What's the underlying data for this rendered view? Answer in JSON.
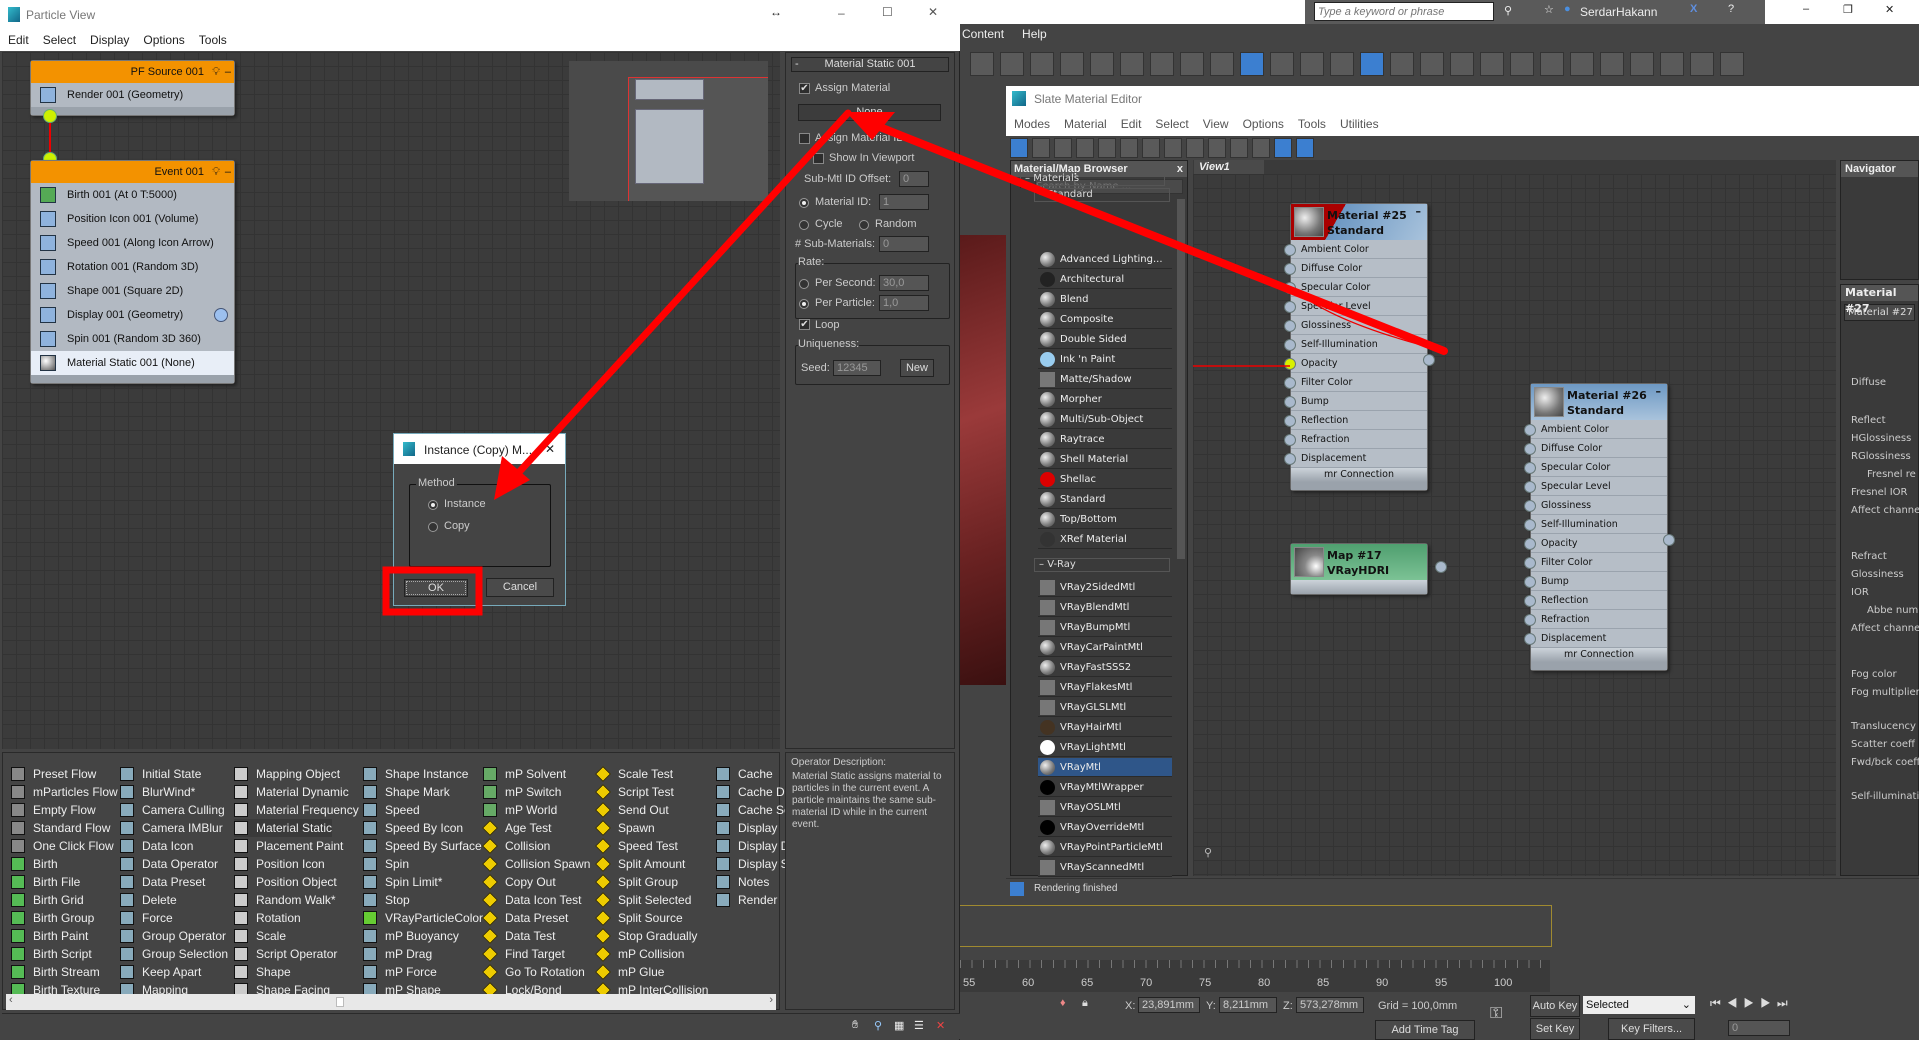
{
  "particle_view": {
    "title": "Particle View",
    "menu": [
      "Edit",
      "Select",
      "Display",
      "Options",
      "Tools"
    ],
    "pf_source": {
      "title": "PF Source 001",
      "rows": [
        "Render 001 (Geometry)"
      ]
    },
    "event": {
      "title": "Event 001",
      "rows": [
        "Birth 001 (At 0 T:5000)",
        "Position Icon 001 (Volume)",
        "Speed 001 (Along Icon Arrow)",
        "Rotation 001 (Random 3D)",
        "Shape 001 (Square 2D)",
        "Display 001 (Geometry)",
        "Spin 001 (Random 3D 360)",
        "Material Static 001 (None)"
      ],
      "selected_row": 7
    },
    "params": {
      "header": "Material Static 001",
      "assign_material": "Assign Material",
      "assign_material_checked": true,
      "material_button": "None",
      "assign_material_id": "Assign Material ID",
      "assign_material_id_checked": false,
      "show_in_viewport": "Show In Viewport",
      "sub_mtl_offset_label": "Sub-Mtl ID Offset:",
      "sub_mtl_offset": "0",
      "material_id_label": "Material ID:",
      "material_id": "1",
      "cycle": "Cycle",
      "random": "Random",
      "sub_materials_label": "# Sub-Materials:",
      "sub_materials": "0",
      "rate_label": "Rate:",
      "per_second_label": "Per Second:",
      "per_second": "30,0",
      "per_particle_label": "Per Particle:",
      "per_particle": "1,0",
      "rate_selected": "Per Particle",
      "loop": "Loop",
      "loop_checked": true,
      "uniqueness_label": "Uniqueness:",
      "seed_label": "Seed:",
      "seed": "12345",
      "new_button": "New"
    },
    "depot_columns": [
      [
        "Preset Flow",
        "mParticles Flow",
        "Empty Flow",
        "Standard Flow",
        "One Click Flow",
        "Birth",
        "Birth File",
        "Birth Grid",
        "Birth Group",
        "Birth Paint",
        "Birth Script",
        "Birth Stream",
        "Birth Texture"
      ],
      [
        "Initial State",
        "BlurWind*",
        "Camera Culling",
        "Camera IMBlur",
        "Data Icon",
        "Data Operator",
        "Data Preset",
        "Delete",
        "Force",
        "Group Operator",
        "Group Selection",
        "Keep Apart",
        "Mapping"
      ],
      [
        "Mapping Object",
        "Material Dynamic",
        "Material Frequency",
        "Material Static",
        "Placement Paint",
        "Position Icon",
        "Position Object",
        "Random Walk*",
        "Rotation",
        "Scale",
        "Script Operator",
        "Shape",
        "Shape Facing"
      ],
      [
        "Shape Instance",
        "Shape Mark",
        "Speed",
        "Speed By Icon",
        "Speed By Surface",
        "Spin",
        "Spin Limit*",
        "Stop",
        "VRayParticleColor",
        "mP Buoyancy",
        "mP Drag",
        "mP Force",
        "mP Shape"
      ],
      [
        "mP Solvent",
        "mP Switch",
        "mP World",
        "Age Test",
        "Collision",
        "Collision Spawn",
        "Copy Out",
        "Data Icon Test",
        "Data Preset",
        "Data Test",
        "Find Target",
        "Go To Rotation",
        "Lock/Bond"
      ],
      [
        "Scale Test",
        "Script Test",
        "Send Out",
        "Spawn",
        "Speed Test",
        "Split Amount",
        "Split Group",
        "Split Selected",
        "Split Source",
        "Stop Gradually",
        "mP Collision",
        "mP Glue",
        "mP InterCollision"
      ],
      [
        "Cache",
        "Cache D",
        "Cache Se",
        "Display",
        "Display D",
        "Display S",
        "Notes",
        "Render"
      ]
    ],
    "depot_selected": "Material Static",
    "description_title": "Operator Description:",
    "description": "Material Static assigns material to particles in the current event. A particle maintains the same sub-material ID while in the current event."
  },
  "dialog": {
    "title": "Instance (Copy) M...",
    "group": "Method",
    "options": [
      "Instance",
      "Copy"
    ],
    "selected": "Instance",
    "ok": "OK",
    "cancel": "Cancel"
  },
  "max": {
    "search_placeholder": "Type a keyword or phrase",
    "user": "SerdarHakann",
    "menu": [
      "Content",
      "Help"
    ],
    "timeline_ticks": [
      "55",
      "60",
      "65",
      "70",
      "75",
      "80",
      "85",
      "90",
      "95",
      "100"
    ],
    "x": "23,891mm",
    "y": "8,211mm",
    "z": "573,278mm",
    "grid": "Grid = 100,0mm",
    "auto_key": "Auto Key",
    "set_key": "Set Key",
    "key_mode": "Selected",
    "key_filters": "Key Filters...",
    "frame": "0",
    "add_time_tag": "Add Time Tag",
    "x_label": "X:",
    "y_label": "Y:",
    "z_label": "Z:"
  },
  "slate": {
    "title": "Slate Material Editor",
    "menu": [
      "Modes",
      "Material",
      "Edit",
      "Select",
      "View",
      "Options",
      "Tools",
      "Utilities"
    ],
    "browser_title": "Material/Map Browser",
    "search_placeholder": "Search by Name ...",
    "materials_group": "Materials",
    "standard_group": "Standard",
    "standard": [
      "Advanced Lighting...",
      "Architectural",
      "Blend",
      "Composite",
      "Double Sided",
      "Ink 'n Paint",
      "Matte/Shadow",
      "Morpher",
      "Multi/Sub-Object",
      "Raytrace",
      "Shell Material",
      "Shellac",
      "Standard",
      "Top/Bottom",
      "XRef Material"
    ],
    "vray_group": "V-Ray",
    "vray": [
      "VRay2SidedMtl",
      "VRayBlendMtl",
      "VRayBumpMtl",
      "VRayCarPaintMtl",
      "VRayFastSSS2",
      "VRayFlakesMtl",
      "VRayGLSLMtl",
      "VRayHairMtl",
      "VRayLightMtl",
      "VRayMtl",
      "VRayMtlWrapper",
      "VRayOSLMtl",
      "VRayOverrideMtl",
      "VRayPointParticleMtl",
      "VRayScannedMtl"
    ],
    "vray_selected": "VRayMtl",
    "view_tab": "View1",
    "status": "Rendering finished",
    "navigator": "Navigator",
    "mat25": {
      "name": "Material #25",
      "type": "Standard"
    },
    "mat26": {
      "name": "Material #26",
      "type": "Standard"
    },
    "map17": {
      "name": "Map #17",
      "type": "VRayHDRI"
    },
    "slots": [
      "Ambient Color",
      "Diffuse Color",
      "Specular Color",
      "Specular Level",
      "Glossiness",
      "Self-Illumination",
      "Opacity",
      "Filter Color",
      "Bump",
      "Reflection",
      "Refraction",
      "Displacement"
    ],
    "mr_connection": "mr Connection",
    "param_title": "Material #27",
    "param_name": "Material #27",
    "param_labels": [
      "Diffuse",
      "Reflect",
      "HGlossiness",
      "RGlossiness",
      "Fresnel re",
      "Fresnel IOR",
      "Affect channe",
      "Refract",
      "Glossiness",
      "IOR",
      "Abbe numb",
      "Affect channe",
      "Fog color",
      "Fog multiplier",
      "Translucency",
      "Scatter coeff",
      "Fwd/bck coeff",
      "Self-illuminatio"
    ]
  },
  "colors": {
    "accent": "#f39200",
    "port": "#cdf000",
    "annotation": "#ff0000",
    "selection": "#2f5689"
  }
}
